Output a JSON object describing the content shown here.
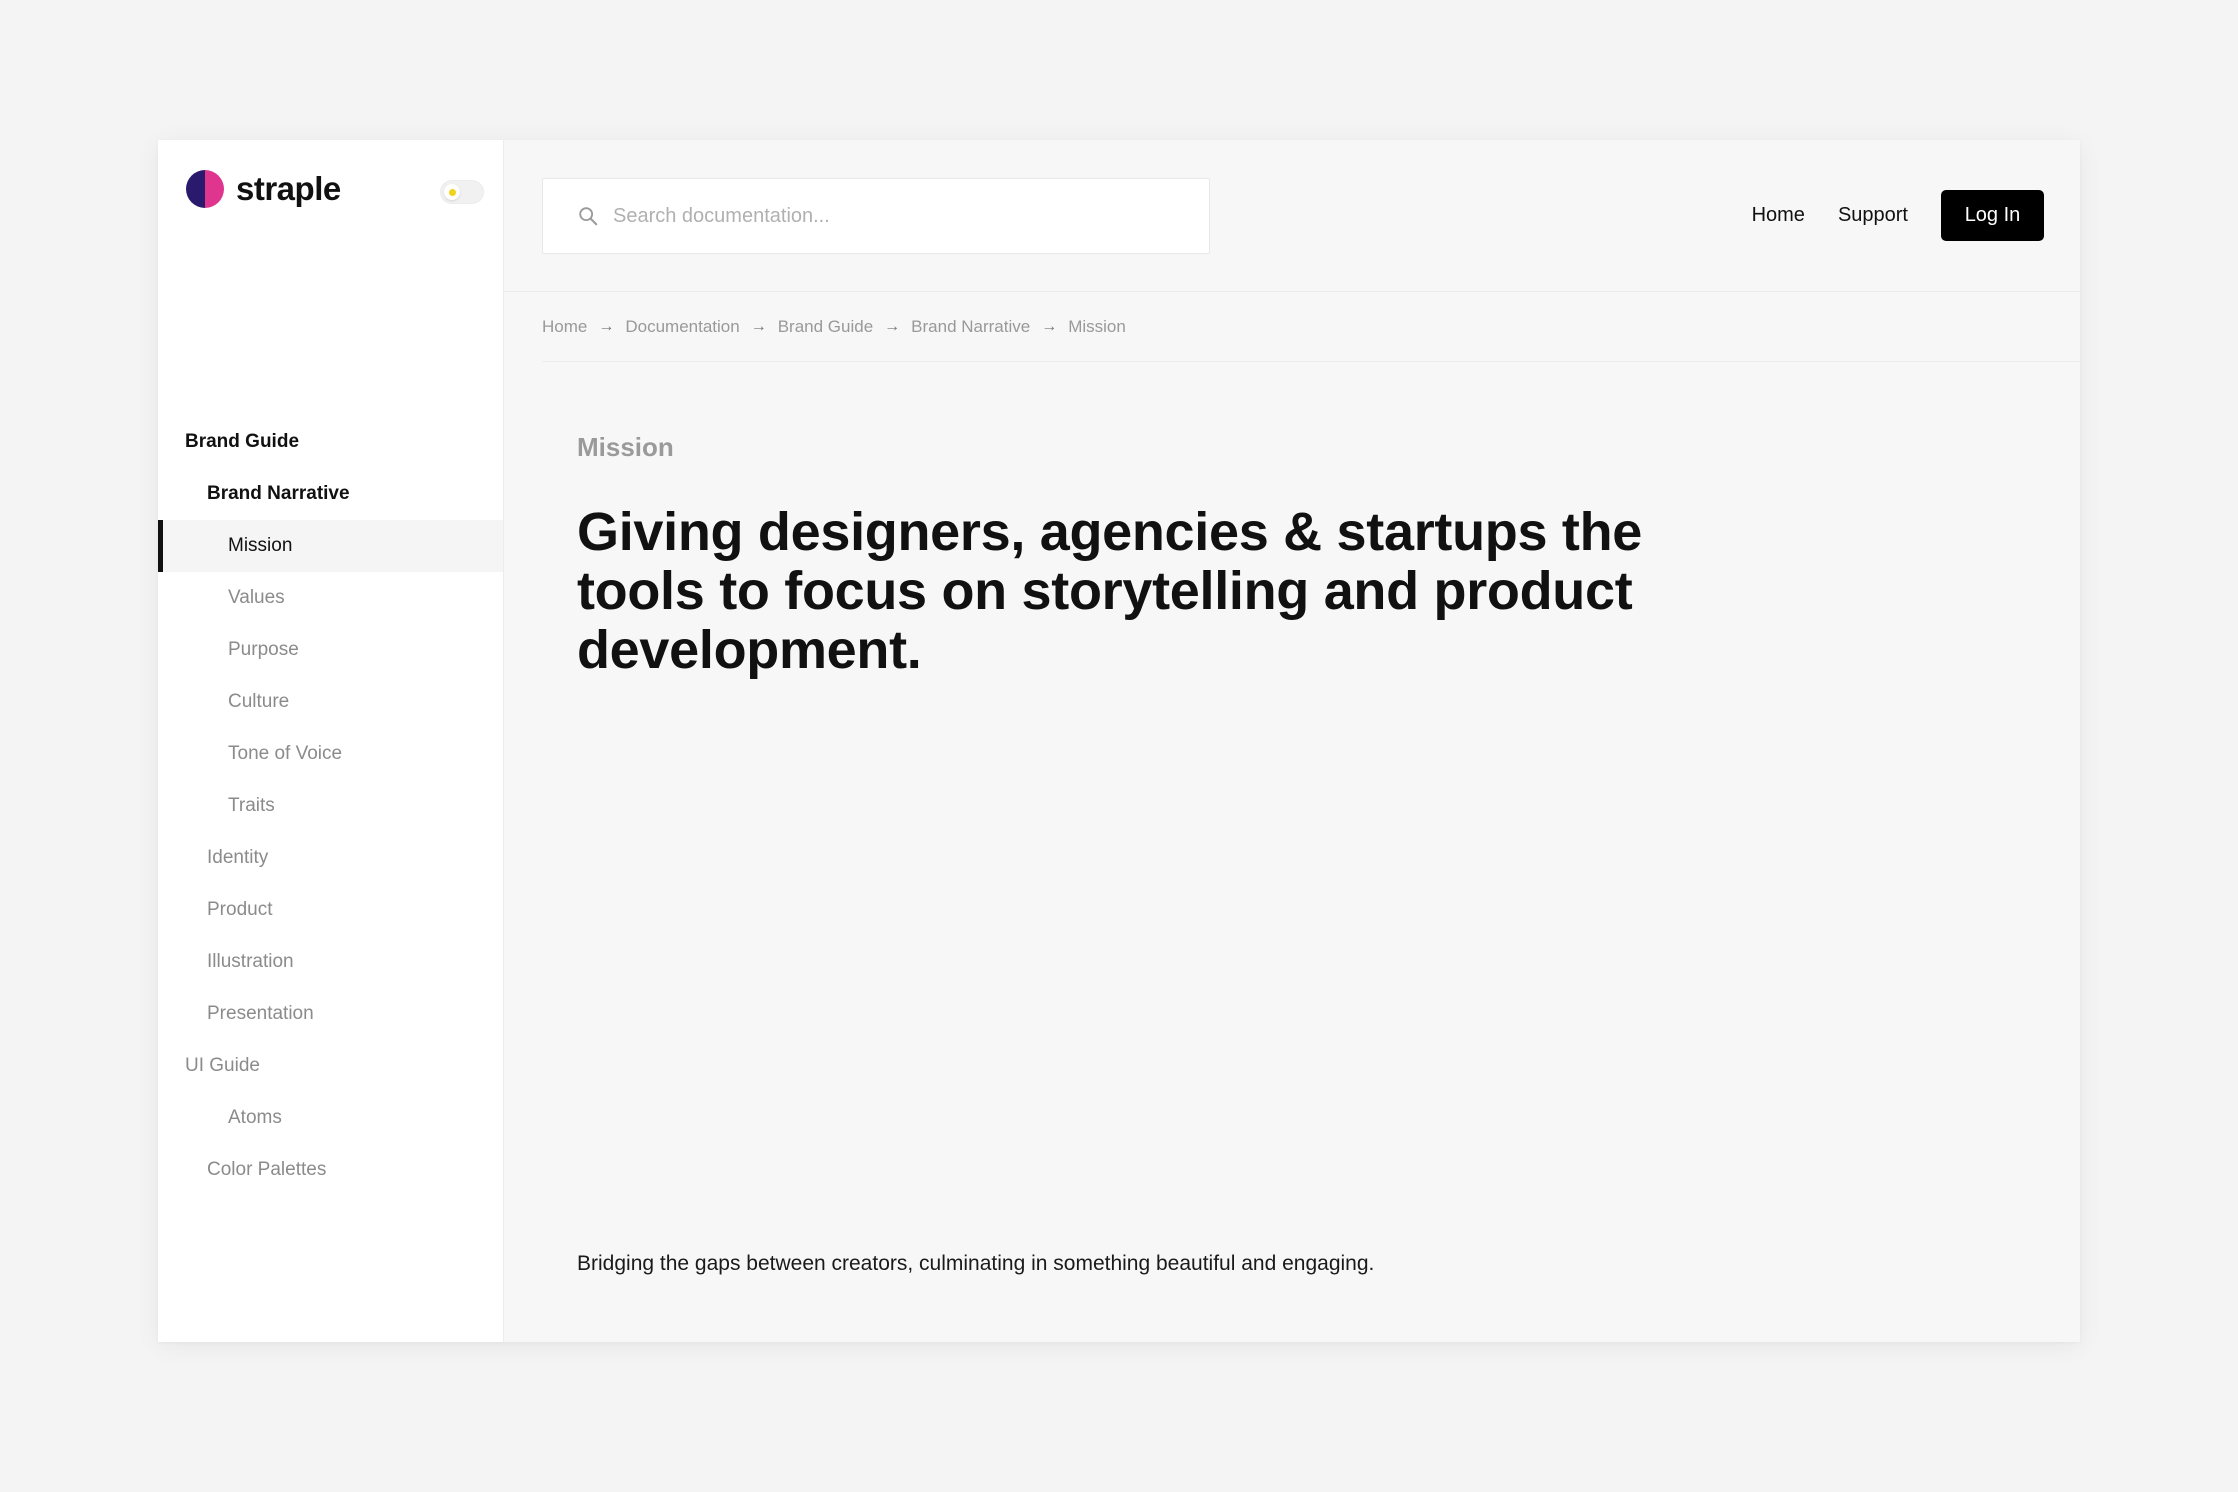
{
  "brand": {
    "name": "straple"
  },
  "sidebar": {
    "items": [
      {
        "label": "Brand Guide",
        "level": 0,
        "bold": true,
        "active": false
      },
      {
        "label": "Brand Narrative",
        "level": 1,
        "bold": true,
        "active": false
      },
      {
        "label": "Mission",
        "level": 2,
        "bold": false,
        "active": true
      },
      {
        "label": "Values",
        "level": 2,
        "bold": false,
        "active": false
      },
      {
        "label": "Purpose",
        "level": 2,
        "bold": false,
        "active": false
      },
      {
        "label": "Culture",
        "level": 2,
        "bold": false,
        "active": false
      },
      {
        "label": "Tone of Voice",
        "level": 2,
        "bold": false,
        "active": false
      },
      {
        "label": "Traits",
        "level": 2,
        "bold": false,
        "active": false
      },
      {
        "label": "Identity",
        "level": 1,
        "bold": false,
        "active": false
      },
      {
        "label": "Product",
        "level": 1,
        "bold": false,
        "active": false
      },
      {
        "label": "Illustration",
        "level": 1,
        "bold": false,
        "active": false
      },
      {
        "label": "Presentation",
        "level": 1,
        "bold": false,
        "active": false
      },
      {
        "label": "UI Guide",
        "level": 0,
        "bold": false,
        "active": false
      },
      {
        "label": "Atoms",
        "level": 2,
        "bold": false,
        "active": false
      },
      {
        "label": "Color Palettes",
        "level": 1,
        "bold": false,
        "active": false
      }
    ]
  },
  "search": {
    "placeholder": "Search documentation..."
  },
  "header": {
    "links": [
      "Home",
      "Support"
    ],
    "login_label": "Log In"
  },
  "breadcrumb": [
    "Home",
    "Documentation",
    "Brand Guide",
    "Brand Narrative",
    "Mission"
  ],
  "main": {
    "title": "Mission",
    "headline": "Giving designers, agencies & startups the tools to focus on storytelling and product development.",
    "lead": "Bridging the gaps between creators, culminating in something beautiful and engaging."
  },
  "colors": {
    "accent_dark": "#2a1a6e",
    "accent_pink": "#e0358f",
    "button": "#000000",
    "toggle_sun": "#f2d21b"
  }
}
